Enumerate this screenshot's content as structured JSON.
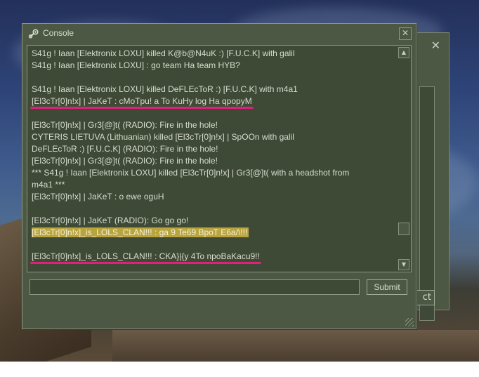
{
  "window": {
    "title": "Console",
    "icon": "steam-icon",
    "close_glyph": "✕"
  },
  "background_window": {
    "close_glyph": "✕",
    "button_fragment": "ct"
  },
  "log": {
    "lines": [
      "S41g ! Iaan [Elektronix LOXU] killed K@b@N4uK :) [F.U.C.K] with galil",
      "S41g ! Iaan [Elektronix LOXU] :  go team Ha team HYB?",
      "",
      "S41g ! Iaan [Elektronix LOXU] killed DeFLEcToR :) [F.U.C.K] with m4a1",
      "[El3cTr[0]n!x]  |  JaKeT :  cMoTpu! a To KuHy log Ha qpopyM",
      "",
      "[El3cTr[0]n!x]  |  Gr3[@]t( (RADIO): Fire in the hole!",
      "CYTERIS LIETUVA (Lithuanian) killed [El3cTr[0]n!x]  |  SpOOn with galil",
      "DeFLEcToR :) [F.U.C.K] (RADIO): Fire in the hole!",
      "[El3cTr[0]n!x]  |  Gr3[@]t( (RADIO): Fire in the hole!",
      "*** S41g ! Iaan [Elektronix LOXU] killed [El3cTr[0]n!x]  |  Gr3[@]t( with a headshot from",
      "m4a1 ***",
      "[El3cTr[0]n!x]  |  JaKeT :  o ewe oguH",
      "",
      "[El3cTr[0]n!x]  |  JaKeT (RADIO): Go go go!",
      "[El3cTr[0]n!x]_is_LOLS_CLAN!!! :  ga 9 Te69 BpoT E6a/\\!!!",
      "",
      "[El3cTr[0]n!x]_is_LOLS_CLAN!!! :  CKA}|{y 4To npoBaKacu9!!"
    ],
    "highlighted_index": 15,
    "underlined_indices": [
      4,
      17
    ],
    "underline_color": "#e0207a",
    "highlight_color": "#b9a43d"
  },
  "input": {
    "value": "",
    "placeholder": ""
  },
  "submit_label": "Submit",
  "scroll": {
    "up_glyph": "▲",
    "down_glyph": "▼"
  }
}
